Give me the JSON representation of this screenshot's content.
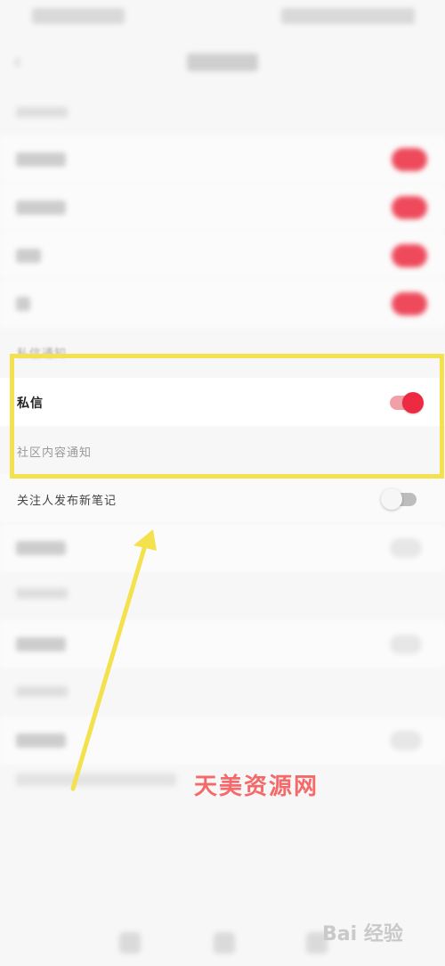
{
  "sections": {
    "private_message_notice": "私信通知",
    "community_notice": "社区内容通知"
  },
  "rows": {
    "private_message": {
      "label": "私信",
      "enabled": true
    },
    "follow_new_note": {
      "label": "关注人发布新笔记",
      "enabled": false
    }
  },
  "annotations": {
    "watermark": "天美资源网",
    "baidu": "Bai 经验"
  },
  "colors": {
    "toggle_on": "#ee2a42",
    "highlight": "#f4e14e",
    "arrow": "#f4e14e"
  }
}
